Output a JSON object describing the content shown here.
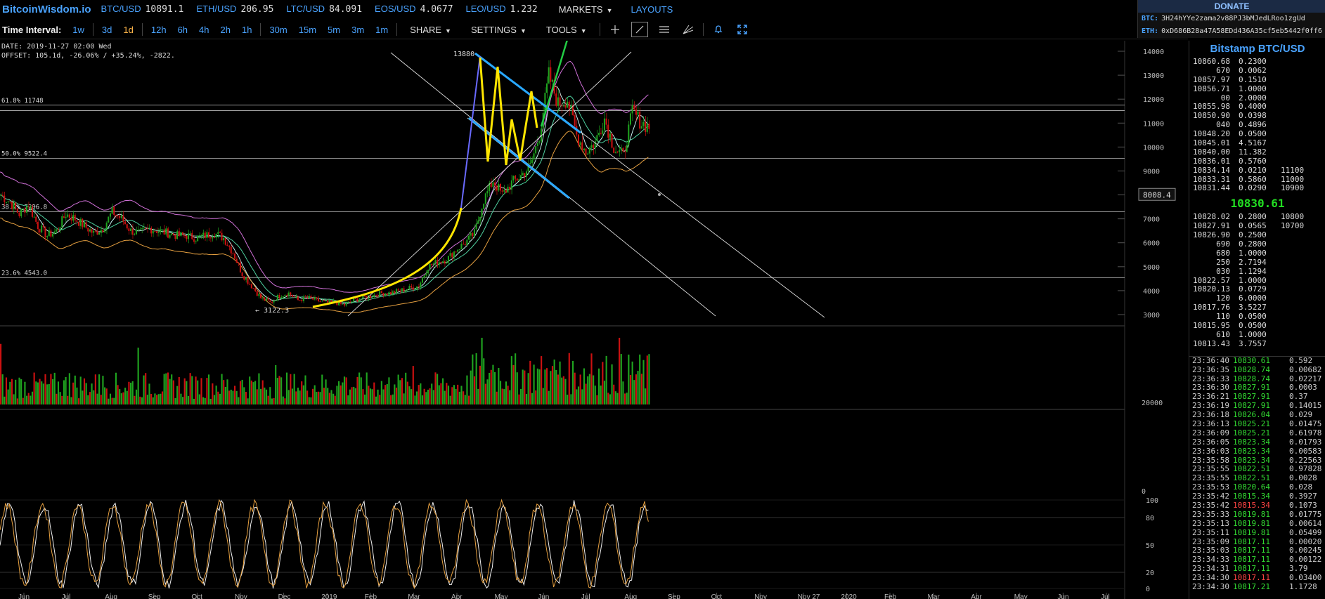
{
  "header": {
    "logo": "BitcoinWisdom.io",
    "tickers": [
      {
        "symbol": "BTC/USD",
        "price": "10891.1"
      },
      {
        "symbol": "ETH/USD",
        "price": "206.95"
      },
      {
        "symbol": "LTC/USD",
        "price": "84.091"
      },
      {
        "symbol": "EOS/USD",
        "price": "4.0677"
      },
      {
        "symbol": "LEO/USD",
        "price": "1.232"
      }
    ],
    "markets_label": "MARKETS",
    "layouts_label": "LAYOUTS"
  },
  "donate": {
    "title": "DONATE",
    "btc_label": "BTC:",
    "btc_address": "3H24hYYe2zama2v88PJ3bMJedLRoo1zgUd",
    "eth_label": "ETH:",
    "eth_address": "0xD686B28a47A58EDd436A35cf5eb5442f0ff6"
  },
  "toolbar": {
    "time_interval_label": "Time Interval:",
    "intervals": [
      "1w",
      "3d",
      "1d",
      "12h",
      "6h",
      "4h",
      "2h",
      "1h",
      "30m",
      "15m",
      "5m",
      "3m",
      "1m"
    ],
    "active_interval": "1d",
    "share_label": "SHARE",
    "settings_label": "SETTINGS",
    "tools_label": "TOOLS"
  },
  "info": {
    "date_line": "DATE: 2019-11-27 02:00 Wed",
    "offset_line": "OFFSET: 105.1d, -26.06% / +35.24%, -2822."
  },
  "chart_data": {
    "type": "candlestick",
    "x_tick_labels": [
      "Jun",
      "Jul",
      "Aug",
      "Sep",
      "Oct",
      "Nov",
      "Dec",
      "2019",
      "Feb",
      "Mar",
      "Apr",
      "May",
      "Jun",
      "Jul",
      "Aug",
      "Sep",
      "Oct",
      "Nov",
      "Nov 27",
      "2020",
      "Feb",
      "Mar",
      "Apr",
      "May",
      "Jun",
      "Jul"
    ],
    "price_axis": {
      "ticks": [
        14000,
        13000,
        12000,
        11000,
        10000,
        9000,
        8000,
        7000,
        6000,
        5000,
        4000,
        3000
      ],
      "range": [
        2500,
        14500
      ]
    },
    "crosshair_price": "8008.4",
    "high_label": "13880",
    "low_label": "← 3122.3",
    "fib_levels": [
      {
        "label": "61.8% 11748",
        "price": 11748
      },
      {
        "label": "50.0% 9522.4",
        "price": 9522.4
      },
      {
        "label": "38.2% 7296.8",
        "price": 7296.8
      },
      {
        "label": "23.6% 4543.0",
        "price": 4543.0
      }
    ],
    "volume_axis": {
      "ticks": [
        20000,
        0
      ]
    },
    "stoch_axis": {
      "ticks": [
        100,
        80,
        50,
        20,
        0
      ]
    },
    "price_path": [
      8000,
      7700,
      7200,
      7600,
      6700,
      6300,
      6500,
      7200,
      7000,
      6700,
      6400,
      6600,
      7300,
      7000,
      6500,
      6400,
      6600,
      6500,
      6400,
      6300,
      6300,
      6200,
      6300,
      6400,
      6200,
      5600,
      4700,
      4200,
      3700,
      3500,
      3800,
      3900,
      3600,
      3700,
      3600,
      3500,
      3500,
      3400,
      3600,
      3700,
      3800,
      3900,
      3900,
      4000,
      4100,
      4200,
      5000,
      5200,
      5300,
      5700,
      6000,
      6400,
      7800,
      8600,
      8000,
      8500,
      8800,
      9200,
      10500,
      13000,
      11800,
      12000,
      10500,
      9800,
      10200,
      11200,
      10000,
      9600,
      11500,
      11000,
      10800
    ]
  },
  "orderbook": {
    "title": "Bitstamp BTC/USD",
    "asks": [
      {
        "p": "10860.68",
        "a": "0.2300",
        "c": ""
      },
      {
        "p": "670",
        "a": "0.0062",
        "c": ""
      },
      {
        "p": "10857.97",
        "a": "0.1510",
        "c": ""
      },
      {
        "p": "10856.71",
        "a": "1.0000",
        "c": ""
      },
      {
        "p": "00",
        "a": "2.0000",
        "c": ""
      },
      {
        "p": "10855.98",
        "a": "0.4000",
        "c": ""
      },
      {
        "p": "10850.90",
        "a": "0.0398",
        "c": ""
      },
      {
        "p": "040",
        "a": "0.4896",
        "c": ""
      },
      {
        "p": "10848.20",
        "a": "0.0500",
        "c": ""
      },
      {
        "p": "10845.01",
        "a": "4.5167",
        "c": ""
      },
      {
        "p": "10840.00",
        "a": "11.382",
        "c": ""
      },
      {
        "p": "10836.01",
        "a": "0.5760",
        "c": ""
      },
      {
        "p": "10834.14",
        "a": "0.0210",
        "c": "11100"
      },
      {
        "p": "10833.31",
        "a": "0.5860",
        "c": "11000"
      },
      {
        "p": "10831.44",
        "a": "0.0290",
        "c": "10900"
      }
    ],
    "last_price": "10830.61",
    "bids": [
      {
        "p": "10828.02",
        "a": "0.2800",
        "c": "10800"
      },
      {
        "p": "10827.91",
        "a": "0.0565",
        "c": "10700"
      },
      {
        "p": "10826.90",
        "a": "0.2500",
        "c": ""
      },
      {
        "p": "690",
        "a": "0.2800",
        "c": ""
      },
      {
        "p": "680",
        "a": "1.0000",
        "c": ""
      },
      {
        "p": "250",
        "a": "2.7194",
        "c": ""
      },
      {
        "p": "030",
        "a": "1.1294",
        "c": ""
      },
      {
        "p": "10822.57",
        "a": "1.0000",
        "c": ""
      },
      {
        "p": "10820.13",
        "a": "0.0729",
        "c": ""
      },
      {
        "p": "120",
        "a": "6.0000",
        "c": ""
      },
      {
        "p": "10817.76",
        "a": "3.5227",
        "c": ""
      },
      {
        "p": "110",
        "a": "0.0500",
        "c": ""
      },
      {
        "p": "10815.95",
        "a": "0.0500",
        "c": ""
      },
      {
        "p": "610",
        "a": "1.0000",
        "c": ""
      },
      {
        "p": "10813.43",
        "a": "3.7557",
        "c": ""
      }
    ],
    "trades": [
      {
        "t": "23:36:40",
        "p": "10830.61",
        "a": "0.592",
        "d": "up"
      },
      {
        "t": "23:36:35",
        "p": "10828.74",
        "a": "0.00682",
        "d": "up"
      },
      {
        "t": "23:36:33",
        "p": "10828.74",
        "a": "0.02217",
        "d": "up"
      },
      {
        "t": "23:36:30",
        "p": "10827.91",
        "a": "0.0003",
        "d": "up"
      },
      {
        "t": "23:36:21",
        "p": "10827.91",
        "a": "0.37",
        "d": "up"
      },
      {
        "t": "23:36:19",
        "p": "10827.91",
        "a": "0.14015",
        "d": "up"
      },
      {
        "t": "23:36:18",
        "p": "10826.04",
        "a": "0.029",
        "d": "up"
      },
      {
        "t": "23:36:13",
        "p": "10825.21",
        "a": "0.01475",
        "d": "up"
      },
      {
        "t": "23:36:09",
        "p": "10825.21",
        "a": "0.61978",
        "d": "up"
      },
      {
        "t": "23:36:05",
        "p": "10823.34",
        "a": "0.01793",
        "d": "up"
      },
      {
        "t": "23:36:03",
        "p": "10823.34",
        "a": "0.00583",
        "d": "up"
      },
      {
        "t": "23:35:58",
        "p": "10823.34",
        "a": "0.22563",
        "d": "up"
      },
      {
        "t": "23:35:55",
        "p": "10822.51",
        "a": "0.97828",
        "d": "up"
      },
      {
        "t": "23:35:55",
        "p": "10822.51",
        "a": "0.0028",
        "d": "up"
      },
      {
        "t": "23:35:53",
        "p": "10820.64",
        "a": "0.028",
        "d": "up"
      },
      {
        "t": "23:35:42",
        "p": "10815.34",
        "a": "0.3927",
        "d": "up"
      },
      {
        "t": "23:35:42",
        "p": "10815.34",
        "a": "0.1073",
        "d": "dn"
      },
      {
        "t": "23:35:33",
        "p": "10819.81",
        "a": "0.01775",
        "d": "up"
      },
      {
        "t": "23:35:13",
        "p": "10819.81",
        "a": "0.00614",
        "d": "up"
      },
      {
        "t": "23:35:11",
        "p": "10819.81",
        "a": "0.05499",
        "d": "up"
      },
      {
        "t": "23:35:09",
        "p": "10817.11",
        "a": "0.00020",
        "d": "up"
      },
      {
        "t": "23:35:03",
        "p": "10817.11",
        "a": "0.00245",
        "d": "up"
      },
      {
        "t": "23:34:33",
        "p": "10817.11",
        "a": "0.00122",
        "d": "up"
      },
      {
        "t": "23:34:31",
        "p": "10817.11",
        "a": "3.79",
        "d": "up"
      },
      {
        "t": "23:34:30",
        "p": "10817.11",
        "a": "0.03400",
        "d": "dn"
      },
      {
        "t": "23:34:30",
        "p": "10817.21",
        "a": "1.1728",
        "d": "up"
      }
    ]
  },
  "colors": {
    "accent": "#4aa3ff",
    "active": "#ffb64a",
    "up": "#33dd33",
    "down": "#ff4444",
    "trend_blue": "#29a8ff",
    "trend_yellow": "#ffe500",
    "trend_green": "#22cc44"
  }
}
